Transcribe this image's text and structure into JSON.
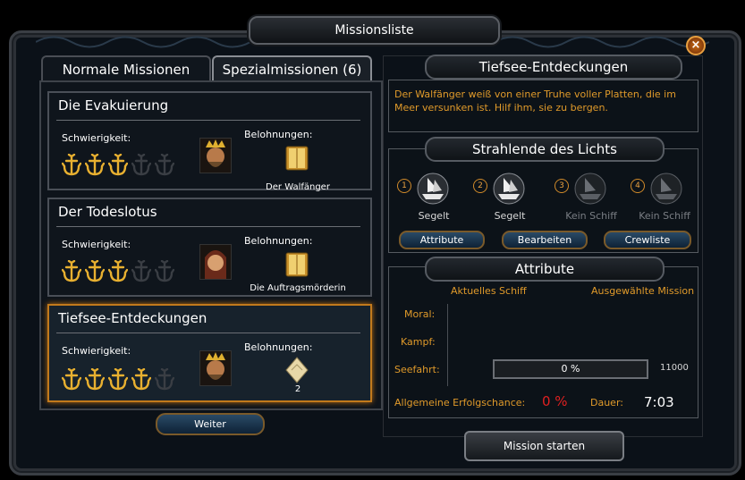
{
  "window": {
    "title": "Missionsliste",
    "close_glyph": "×"
  },
  "tabs": [
    {
      "label": "Normale Missionen"
    },
    {
      "label": "Spezialmissionen (6)"
    }
  ],
  "missions": [
    {
      "title": "Die Evakuierung",
      "difficulty_label": "Schwierigkeit:",
      "difficulty": 3,
      "difficulty_max": 5,
      "rewards_label": "Belohnungen:",
      "reward_name": "Der Walfänger",
      "reward_icon": "book-icon"
    },
    {
      "title": "Der Todeslotus",
      "difficulty_label": "Schwierigkeit:",
      "difficulty": 3,
      "difficulty_max": 5,
      "rewards_label": "Belohnungen:",
      "reward_name": "Die Auftragsmörderin",
      "reward_icon": "book-icon"
    },
    {
      "title": "Tiefsee-Entdeckungen",
      "difficulty_label": "Schwierigkeit:",
      "difficulty": 4,
      "difficulty_max": 5,
      "rewards_label": "Belohnungen:",
      "reward_name": "2",
      "reward_icon": "scroll-icon"
    }
  ],
  "weiter_label": "Weiter",
  "detail": {
    "title": "Tiefsee-Entdeckungen",
    "description": "Der Walfänger weiß von einer Truhe voller Platten, die im Meer versunken ist. Hilf ihm, sie zu bergen."
  },
  "crew": {
    "title": "Strahlende des Lichts",
    "ships": [
      {
        "num": "1",
        "name": "Segelt",
        "active": true
      },
      {
        "num": "2",
        "name": "Segelt",
        "active": true
      },
      {
        "num": "3",
        "name": "Kein Schiff",
        "active": false
      },
      {
        "num": "4",
        "name": "Kein Schiff",
        "active": false
      }
    ],
    "buttons": [
      "Attribute",
      "Bearbeiten",
      "Crewliste"
    ]
  },
  "attributes": {
    "title": "Attribute",
    "col_current": "Aktuelles Schiff",
    "col_selected": "Ausgewählte Mission",
    "rows": [
      "Moral:",
      "Kampf:",
      "Seefahrt:"
    ],
    "seefahrt_progress": "0 %",
    "seefahrt_progress_value": 0,
    "seefahrt_required": "11000",
    "success_label": "Allgemeine Erfolgschance:",
    "success_value": "0 %",
    "duration_label": "Dauer:",
    "duration_value": "7:03"
  },
  "start_label": "Mission starten",
  "colors": {
    "accent": "#e09a2a",
    "selected_border": "#c27a1c",
    "success": "#e02020"
  }
}
